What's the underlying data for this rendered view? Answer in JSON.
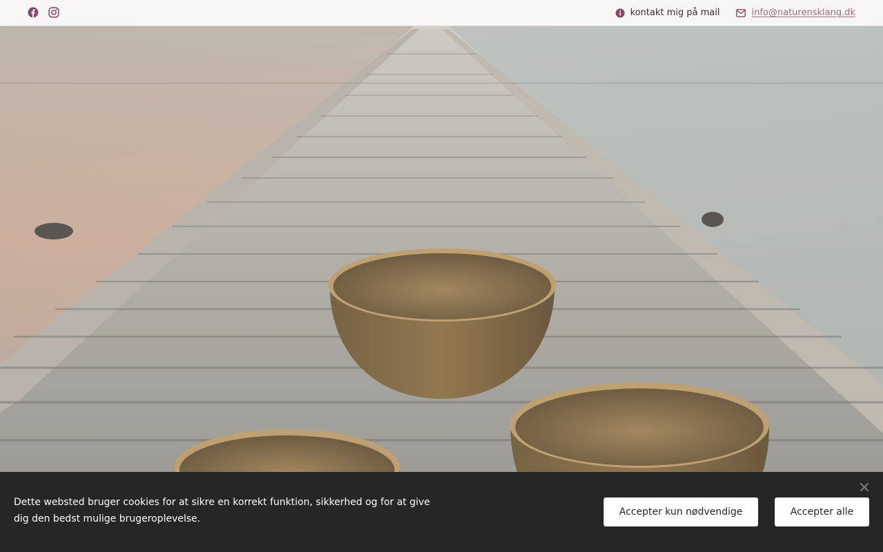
{
  "topbar": {
    "social_icons": [
      "facebook-icon",
      "instagram-icon"
    ],
    "contact_label": "kontakt mig på mail",
    "email": "info@naturensklang.dk",
    "colors": {
      "accent": "#8a4a66",
      "link": "#a06a80",
      "text": "#3b2b33"
    }
  },
  "cookie": {
    "text": "Dette websted bruger cookies for at sikre en korrekt funktion, sikkerhed og for at give dig den bedst mulige brugeroplevelse.",
    "accept_necessary": "Accepter kun nødvendige",
    "accept_all": "Accepter alle",
    "colors": {
      "background": "#262626",
      "button": "#ffffff"
    }
  }
}
